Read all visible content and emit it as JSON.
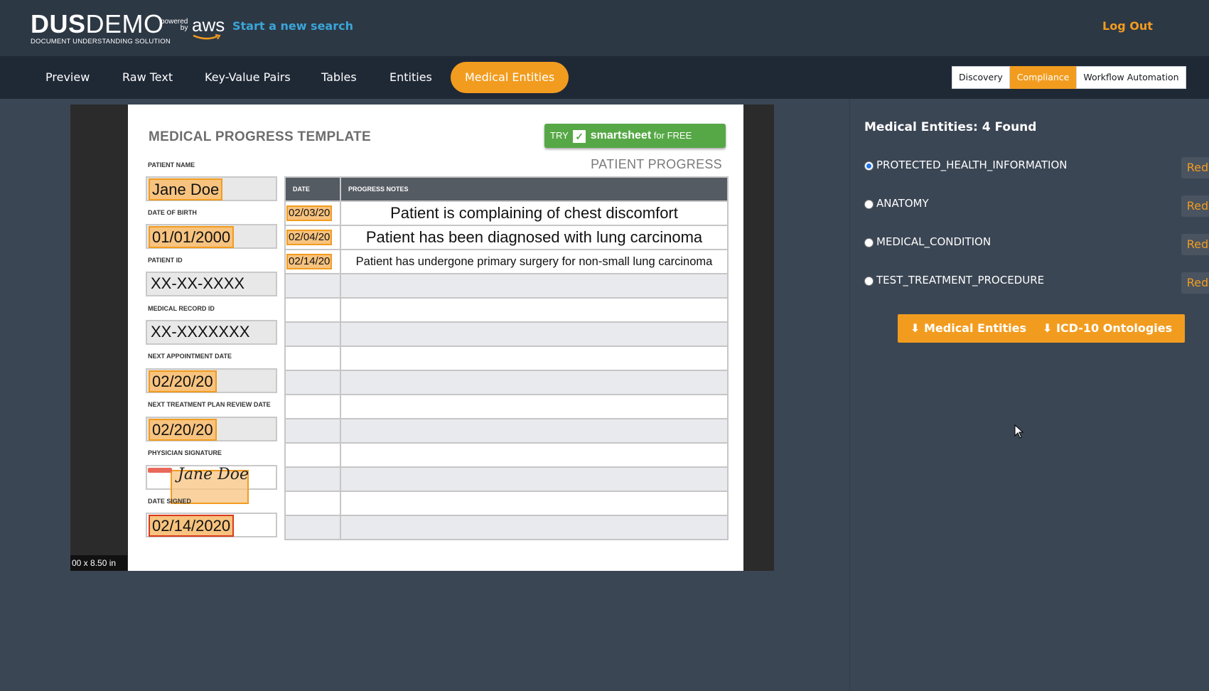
{
  "header": {
    "logo_bold": "DUS",
    "logo_light": "DEMO",
    "logo_sub": "DOCUMENT UNDERSTANDING SOLUTION",
    "powered_1": "powered",
    "powered_2": "by",
    "aws": "aws",
    "new_search": "Start a new search",
    "logout": "Log Out"
  },
  "nav": {
    "tabs": [
      {
        "label": "Preview"
      },
      {
        "label": "Raw Text"
      },
      {
        "label": "Key-Value Pairs"
      },
      {
        "label": "Tables"
      },
      {
        "label": "Entities"
      },
      {
        "label": "Medical Entities",
        "active": true
      }
    ],
    "modes": [
      {
        "label": "Discovery"
      },
      {
        "label": "Compliance",
        "active": true
      },
      {
        "label": "Workflow Automation"
      }
    ]
  },
  "document": {
    "size_label": "00 x 8.50 in",
    "title": "MEDICAL PROGRESS TEMPLATE",
    "try_btn": {
      "try": "TRY",
      "brand": "smartsheet",
      "suffix": "for FREE"
    },
    "patient_progress": "PATIENT PROGRESS",
    "fields": [
      {
        "label": "PATIENT NAME",
        "value": "Jane Doe"
      },
      {
        "label": "DATE OF BIRTH",
        "value": "01/01/2000"
      },
      {
        "label": "PATIENT ID",
        "value": "XX-XX-XXXX"
      },
      {
        "label": "MEDICAL RECORD ID",
        "value": "XX-XXXXXXX"
      },
      {
        "label": "NEXT APPOINTMENT DATE",
        "value": "02/20/20"
      },
      {
        "label": "NEXT TREATMENT PLAN REVIEW DATE",
        "value": "02/20/20"
      },
      {
        "label": "PHYSICIAN SIGNATURE",
        "value": "Jane Doe"
      },
      {
        "label": "DATE SIGNED",
        "value": "02/14/2020"
      }
    ],
    "table": {
      "headers": [
        "DATE",
        "PROGRESS NOTES"
      ],
      "rows": [
        {
          "date": "02/03/20",
          "note": "Patient is complaining of chest discomfort"
        },
        {
          "date": "02/04/20",
          "note": "Patient has been diagnosed with lung carcinoma"
        },
        {
          "date": "02/14/20",
          "note": "Patient has undergone primary surgery for non-small lung carcinoma"
        }
      ]
    }
  },
  "panel": {
    "title": "Medical Entities: 4 Found",
    "entities": [
      {
        "label": "PROTECTED_HEALTH_INFORMATION",
        "checked": true
      },
      {
        "label": "ANATOMY"
      },
      {
        "label": "MEDICAL_CONDITION"
      },
      {
        "label": "TEST_TREATMENT_PROCEDURE"
      }
    ],
    "redact_label": "Redact",
    "download_medical": "⬇ Medical Entities",
    "download_icd": "⬇ ICD-10 Ontologies"
  },
  "colors": {
    "accent": "#f29c1f",
    "link": "#3aa5d8",
    "header_bg": "#2d3845",
    "nav_bg": "#1f2936",
    "body_bg": "#3b4654"
  }
}
